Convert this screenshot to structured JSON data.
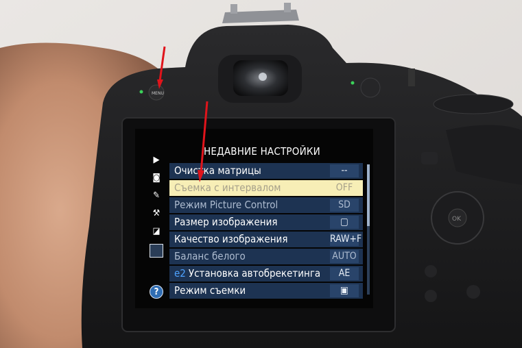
{
  "menu": {
    "title": "НЕДАВНИЕ НАСТРОЙКИ",
    "items": [
      {
        "label": "Очистка матрицы",
        "value": "--"
      },
      {
        "label": "Съемка с интервалом",
        "value": "OFF"
      },
      {
        "label": "Режим Picture Control",
        "value": "SD"
      },
      {
        "label": "Размер изображения",
        "value": "▢"
      },
      {
        "label": "Качество изображения",
        "value": "RAW+F"
      },
      {
        "label": "Баланс белого",
        "value": "AUTO"
      },
      {
        "label": "Установка автобрекетинга",
        "value": "AE",
        "prefix": "e2"
      },
      {
        "label": "Режим съемки",
        "value": "▣"
      }
    ],
    "sidebar_icons": [
      "playback-icon",
      "camera-icon",
      "pencil-icon",
      "wrench-icon",
      "retouch-icon",
      "recent-settings-icon",
      "help-icon"
    ]
  },
  "camera": {
    "menu_button_label": "MENU"
  },
  "colors": {
    "highlight": "#f7eeb6",
    "row_bg": "#1d3352",
    "arrow": "#e0141b"
  }
}
